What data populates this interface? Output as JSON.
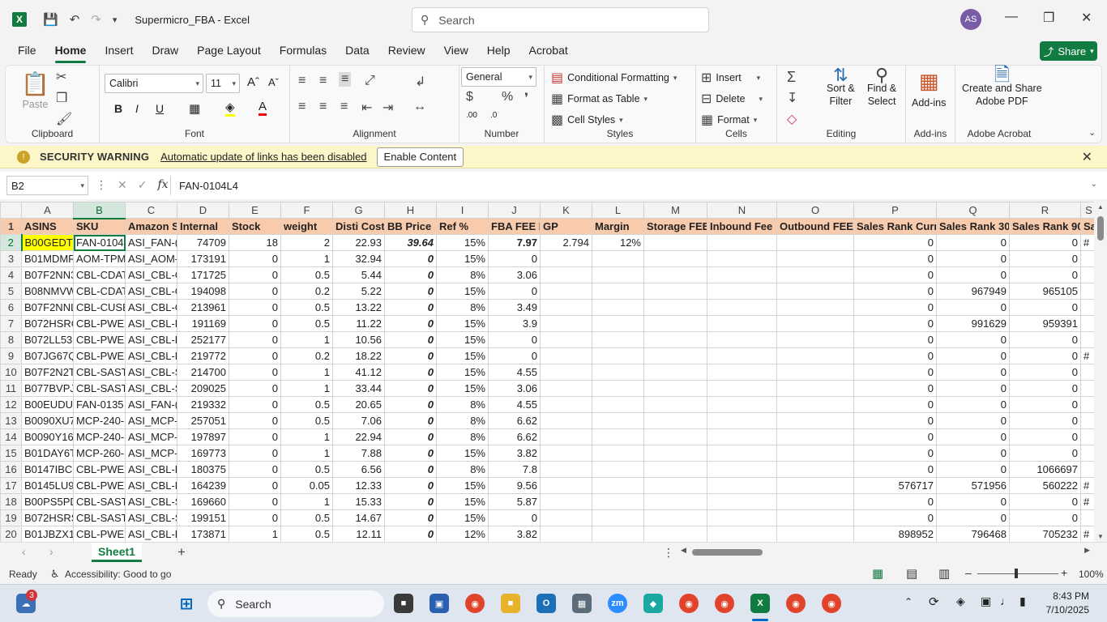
{
  "app": {
    "title": "Supermicro_FBA  -  Excel",
    "search_placeholder": "Search",
    "user_initials": "AS"
  },
  "menu": {
    "tabs": [
      "File",
      "Home",
      "Insert",
      "Draw",
      "Page Layout",
      "Formulas",
      "Data",
      "Review",
      "View",
      "Help",
      "Acrobat"
    ],
    "active": "Home",
    "share_label": "Share"
  },
  "ribbon": {
    "clipboard": {
      "paste": "Paste",
      "label": "Clipboard"
    },
    "font": {
      "name": "Calibri",
      "size": "11",
      "label": "Font"
    },
    "alignment": {
      "label": "Alignment"
    },
    "number": {
      "format": "General",
      "label": "Number"
    },
    "styles": {
      "conditional": "Conditional Formatting",
      "format_table": "Format as Table",
      "cell_styles": "Cell Styles",
      "label": "Styles"
    },
    "cells": {
      "insert": "Insert",
      "delete": "Delete",
      "format": "Format",
      "label": "Cells"
    },
    "editing": {
      "sort": "Sort &",
      "filter": "Filter",
      "find": "Find &",
      "select": "Select",
      "label": "Editing"
    },
    "addins": {
      "btn": "Add-ins",
      "label": "Add-ins"
    },
    "acrobat": {
      "line1": "Create and Share",
      "line2": "Adobe PDF",
      "label": "Adobe Acrobat"
    }
  },
  "security": {
    "title": "SECURITY WARNING",
    "message": "Automatic update of links has been disabled",
    "button": "Enable Content"
  },
  "formula_bar": {
    "name_box": "B2",
    "formula": "FAN-0104L4"
  },
  "grid": {
    "columns": [
      "A",
      "B",
      "C",
      "D",
      "E",
      "F",
      "G",
      "H",
      "I",
      "J",
      "K",
      "L",
      "M",
      "N",
      "O",
      "P",
      "Q",
      "R",
      "S"
    ],
    "header_row": [
      "ASINS",
      "SKU",
      "Amazon S",
      "Internal",
      "Stock",
      "weight",
      "Disti Cost",
      "BB Price",
      "Ref %",
      "FBA FEE P",
      "GP",
      "Margin",
      "Storage FEE",
      "Inbound Fee",
      "Outbound FEE",
      "Sales Rank Curr",
      "Sales Rank 30",
      "Sales Rank 90",
      "Sa"
    ],
    "rows": [
      [
        "B00GEDTZ",
        "FAN-0104",
        "ASI_FAN-(",
        "74709",
        "18",
        "2",
        "22.93",
        "39.64",
        "15%",
        "7.97",
        "2.794",
        "12%",
        "",
        "",
        "",
        "0",
        "0",
        "0",
        "#"
      ],
      [
        "B01MDMR",
        "AOM-TPM",
        "ASI_AOM-",
        "173191",
        "0",
        "1",
        "32.94",
        "0",
        "15%",
        "0",
        "",
        "",
        "",
        "",
        "",
        "0",
        "0",
        "0",
        ""
      ],
      [
        "B07F2NN3",
        "CBL-CDAT",
        "ASI_CBL-C",
        "171725",
        "0",
        "0.5",
        "5.44",
        "0",
        "8%",
        "3.06",
        "",
        "",
        "",
        "",
        "",
        "0",
        "0",
        "0",
        ""
      ],
      [
        "B08NMVW",
        "CBL-CDAT",
        "ASI_CBL-C",
        "194098",
        "0",
        "0.2",
        "5.22",
        "0",
        "15%",
        "0",
        "",
        "",
        "",
        "",
        "",
        "0",
        "967949",
        "965105",
        ""
      ],
      [
        "B07F2NNL",
        "CBL-CUSB",
        "ASI_CBL-C",
        "213961",
        "0",
        "0.5",
        "13.22",
        "0",
        "8%",
        "3.49",
        "",
        "",
        "",
        "",
        "",
        "0",
        "0",
        "0",
        ""
      ],
      [
        "B072HSRC",
        "CBL-PWEX",
        "ASI_CBL-P",
        "191169",
        "0",
        "0.5",
        "11.22",
        "0",
        "15%",
        "3.9",
        "",
        "",
        "",
        "",
        "",
        "0",
        "991629",
        "959391",
        ""
      ],
      [
        "B072LL53R",
        "CBL-PWEX",
        "ASI_CBL-P",
        "252177",
        "0",
        "1",
        "10.56",
        "0",
        "15%",
        "0",
        "",
        "",
        "",
        "",
        "",
        "0",
        "0",
        "0",
        ""
      ],
      [
        "B07JG67Q",
        "CBL-PWEX",
        "ASI_CBL-P",
        "219772",
        "0",
        "0.2",
        "18.22",
        "0",
        "15%",
        "0",
        "",
        "",
        "",
        "",
        "",
        "0",
        "0",
        "0",
        "#"
      ],
      [
        "B07F2N2T",
        "CBL-SAST-",
        "ASI_CBL-S",
        "214700",
        "0",
        "1",
        "41.12",
        "0",
        "15%",
        "4.55",
        "",
        "",
        "",
        "",
        "",
        "0",
        "0",
        "0",
        ""
      ],
      [
        "B077BVPJ",
        "CBL-SAST-",
        "ASI_CBL-S",
        "209025",
        "0",
        "1",
        "33.44",
        "0",
        "15%",
        "3.06",
        "",
        "",
        "",
        "",
        "",
        "0",
        "0",
        "0",
        ""
      ],
      [
        "B00EUDU(",
        "FAN-0135",
        "ASI_FAN-(",
        "219332",
        "0",
        "0.5",
        "20.65",
        "0",
        "8%",
        "4.55",
        "",
        "",
        "",
        "",
        "",
        "0",
        "0",
        "0",
        ""
      ],
      [
        "B0090XU7",
        "MCP-240-(",
        "ASI_MCP-",
        "257051",
        "0",
        "0.5",
        "7.06",
        "0",
        "8%",
        "6.62",
        "",
        "",
        "",
        "",
        "",
        "0",
        "0",
        "0",
        ""
      ],
      [
        "B0090Y16A",
        "MCP-240-(",
        "ASI_MCP-",
        "197897",
        "0",
        "1",
        "22.94",
        "0",
        "8%",
        "6.62",
        "",
        "",
        "",
        "",
        "",
        "0",
        "0",
        "0",
        ""
      ],
      [
        "B01DAY6T",
        "MCP-260-(",
        "ASI_MCP-",
        "169773",
        "0",
        "1",
        "7.88",
        "0",
        "15%",
        "3.82",
        "",
        "",
        "",
        "",
        "",
        "0",
        "0",
        "0",
        ""
      ],
      [
        "B0147IBC1",
        "CBL-PWEX",
        "ASI_CBL-P",
        "180375",
        "0",
        "0.5",
        "6.56",
        "0",
        "8%",
        "7.8",
        "",
        "",
        "",
        "",
        "",
        "0",
        "0",
        "1066697",
        ""
      ],
      [
        "B0145LU9I",
        "CBL-PWEX",
        "ASI_CBL-P",
        "164239",
        "0",
        "0.05",
        "12.33",
        "0",
        "15%",
        "9.56",
        "",
        "",
        "",
        "",
        "",
        "576717",
        "571956",
        "560222",
        "#"
      ],
      [
        "B00PS5PD",
        "CBL-SAST-",
        "ASI_CBL-S",
        "169660",
        "0",
        "1",
        "15.33",
        "0",
        "15%",
        "5.87",
        "",
        "",
        "",
        "",
        "",
        "0",
        "0",
        "0",
        "#"
      ],
      [
        "B072HSRS",
        "CBL-SAST-",
        "ASI_CBL-S",
        "199151",
        "0",
        "0.5",
        "14.67",
        "0",
        "15%",
        "0",
        "",
        "",
        "",
        "",
        "",
        "0",
        "0",
        "0",
        ""
      ],
      [
        "B01JBZX1(",
        "CBL-PWEX",
        "ASI_CBL-P",
        "173871",
        "1",
        "0.5",
        "12.11",
        "0",
        "12%",
        "3.82",
        "",
        "",
        "",
        "",
        "",
        "898952",
        "796468",
        "705232",
        "#"
      ]
    ]
  },
  "sheets": {
    "tabs": [
      "Sheet1"
    ],
    "add_label": "+"
  },
  "status": {
    "ready": "Ready",
    "accessibility": "Accessibility: Good to go",
    "zoom": "100%"
  },
  "taskbar": {
    "search": "Search",
    "time": "8:43 PM",
    "date": "7/10/2025",
    "badge": "3"
  },
  "colors": {
    "accent": "#107c41",
    "header_fill": "#f8cbad",
    "highlight": "#ffff00",
    "warning_bar": "#fdf6c8"
  },
  "icons": [
    "save-icon",
    "undo-icon",
    "redo-icon",
    "search-icon",
    "paste-icon",
    "cut-icon",
    "copy-icon",
    "format-painter-icon",
    "bold-icon",
    "italic-icon",
    "underline-icon",
    "border-icon",
    "fill-color-icon",
    "font-color-icon",
    "autosum-icon",
    "sort-filter-icon",
    "find-icon",
    "addins-icon",
    "pdf-icon",
    "shield-icon",
    "close-icon",
    "windows-icon"
  ]
}
